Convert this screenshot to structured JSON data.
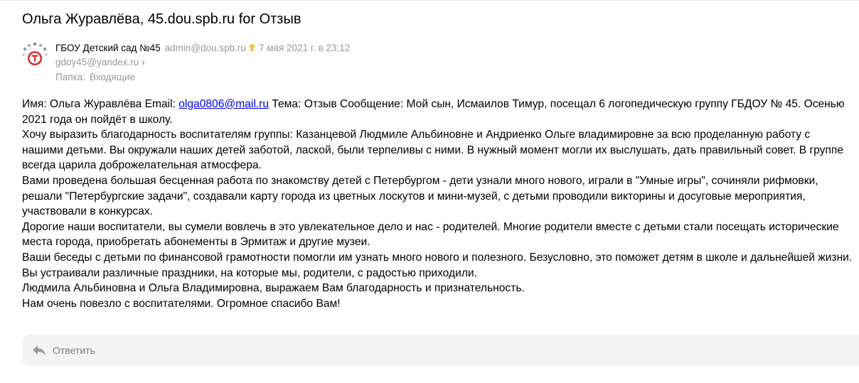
{
  "message": {
    "subject": "Ольга Журавлёва, 45.dou.spb.ru for Отзыв",
    "sender_name": "ГБОУ Детский сад №45",
    "sender_email": "admin@dou.spb.ru",
    "date": "7 мая 2021 г. в 23:12",
    "recipient": "gdoy45@yandex.ru",
    "folder_label": "Папка:",
    "folder_name": "Входящие",
    "avatar_icon": "kindergarten-logo-icon",
    "accent_colors": {
      "logo_red": "#d72a2a",
      "link": "#0000ee",
      "muted": "#999999"
    }
  },
  "body": {
    "line1_prefix": "Имя: Ольга Журавлёва Email: ",
    "email_link": "olga0806@mail.ru",
    "line1_suffix": " Тема: Отзыв Сообщение: Мой сын, Исмаилов Тимур, посещал 6 логопедическую группу ГБДОУ № 45. Осенью 2021 года он пойдёт в школу.",
    "paragraphs": [
      "Хочу выразить благодарность воспитателям группы: Казанцевой Людмиле Альбиновне и Андриенко Ольге владимировне за всю проделанную работу с нашими детьми. Вы окружали наших детей заботой, лаской, были терпеливы с ними. В нужный момент могли их выслушать, дать правильный совет. В группе всегда царила доброжелательная атмосфера.",
      "Вами проведена большая бесценная работа по знакомству детей с Петербургом - дети узнали много нового, играли в \"Умные игры\", сочиняли рифмовки, решали \"Петербургские задачи\", создавали карту города из цветных лоскутов и мини-музей, с детьми проводили викторины и досуговые мероприятия, участвовали в конкурсах.",
      "Дорогие наши воспитатели, вы сумели вовлечь в это увлекательное дело и нас - родителей. Многие родители вместе с детьми стали посещать исторические места города, приобретать абонементы в Эрмитаж и другие музеи.",
      "Ваши беседы с детьми по финансовой грамотности помогли им узнать много нового и полезного. Безусловно, это поможет детям в школе и дальнейшей жизни.",
      "Вы устраивали различные праздники, на которые мы, родители, с радостью приходили.",
      "Людмила Альбиновна и Ольга Владимировна, выражаем Вам благодарность и признательность.",
      "Нам очень повезло с воспитателями. Огромное спасибо Вам!"
    ]
  },
  "actions": {
    "reply_label": "Ответить",
    "reply_icon": "reply-arrow-icon"
  }
}
